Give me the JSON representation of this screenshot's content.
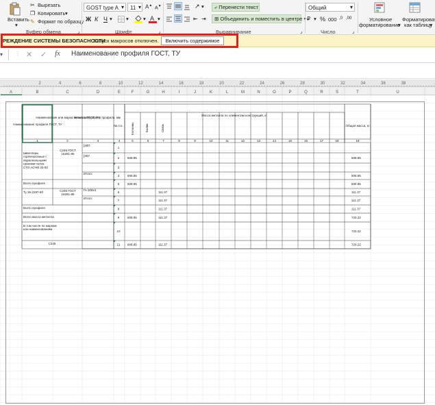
{
  "ribbon": {
    "clipboard": {
      "paste_label": "Вставить",
      "cut_label": "Вырезать",
      "copy_label": "Копировать",
      "format_painter_label": "Формат по образцу",
      "group_label": "Буфер обмена"
    },
    "font": {
      "font_name": "GOST type A",
      "font_size": "11",
      "bold": "Ж",
      "italic": "К",
      "underline": "Ч",
      "group_label": "Шрифт"
    },
    "alignment": {
      "wrap_text_label": "Перенести текст",
      "merge_label": "Объединить и поместить в центре",
      "group_label": "Выравнивание"
    },
    "number": {
      "format": "Общий",
      "percent": "%",
      "thousands": "000",
      "dec_inc": ",0",
      "dec_dec": ",00",
      "group_label": "Число"
    },
    "styles": {
      "conditional_label_1": "Условное",
      "conditional_label_2": "форматирование",
      "table_label_1": "Форматировать",
      "table_label_2": "как таблицу"
    },
    "colors": {
      "accent_green": "#217346",
      "font_red": "#e0201e",
      "fill_yellow": "#ffff00"
    }
  },
  "security_bar": {
    "title": "ПРЕДУПРЕЖДЕНИЕ СИСТЕМЫ БЕЗОПАСНОСТИ",
    "visible_title": "РЕЖДЕНИЕ СИСТЕМЫ БЕЗОПАСНОСТИ",
    "message": "Запуск макросов отключен.",
    "button_label": "Включить содержимое",
    "highlight_color": "#e0201e"
  },
  "formula_bar": {
    "cancel": "✕",
    "confirm": "✓",
    "fx": "fx",
    "content": "Наименование профиля ГОСТ, ТУ"
  },
  "ruler_marks": [
    "2",
    "4",
    "6",
    "8",
    "10",
    "12",
    "14",
    "16",
    "18",
    "20",
    "22",
    "24",
    "26",
    "28",
    "30",
    "32",
    "34",
    "36",
    "38"
  ],
  "columns": [
    "A",
    "B",
    "C",
    "D",
    "E",
    "F",
    "G",
    "H",
    "I",
    "J",
    "K",
    "L",
    "M",
    "N",
    "O",
    "P",
    "Q",
    "R",
    "S",
    "T",
    "U"
  ],
  "table": {
    "headers": {
      "col1": "Наименование профиля ГОСТ, ТУ",
      "col2": "Наименование или марка металла ГОСТ, ТУ",
      "col3": "Номер или размер профиля, мм",
      "col4": "№ п.п.",
      "mass_group": "Масса металла по элементам конструкций, кг",
      "el_kolonny": "Колонны",
      "el_balki": "Балки",
      "el_svyazi": "Связь",
      "total": "Общая масса, кг"
    },
    "index_row": [
      "1",
      "2",
      "3",
      "4",
      "5",
      "6",
      "7",
      "8",
      "9",
      "10",
      "11",
      "12",
      "13",
      "14",
      "15",
      "16",
      "17",
      "18",
      "19"
    ],
    "rows": [
      {
        "name": "Швеллеры горячекатаные с параллельными гранями полок СТО АСЧМ 20-93",
        "steel": "С245 ГОСТ 16281-85",
        "profile": "[30П",
        "nn": "1",
        "kol": "",
        "svyaz": "",
        "total": ""
      },
      {
        "name": "",
        "steel": "",
        "profile": "[30У",
        "nn": "2",
        "kol": "608.85",
        "svyaz": "",
        "total": "608.85"
      },
      {
        "name": "",
        "steel": "",
        "profile": "",
        "nn": "3",
        "kol": "",
        "svyaz": "",
        "total": ""
      },
      {
        "name": "",
        "steel": "",
        "profile": "Итого:",
        "nn": "4",
        "kol": "608.85",
        "svyaz": "",
        "total": "608.85"
      },
      {
        "name": "Всего профиля",
        "steel": "",
        "profile": "",
        "nn": "5",
        "kol": "608.85",
        "svyaz": "",
        "total": "608.85"
      },
      {
        "name": "Ту 36-2287-80",
        "steel": "С245 ГОСТ 16281-85",
        "profile": "Гн.100х4",
        "nn": "6",
        "kol": "",
        "svyaz": "111.37",
        "total": "111.37"
      },
      {
        "name": "",
        "steel": "",
        "profile": "Итого:",
        "nn": "7",
        "kol": "",
        "svyaz": "111.37",
        "total": "111.37"
      },
      {
        "name": "Всего профиля",
        "steel": "",
        "profile": "",
        "nn": "8",
        "kol": "",
        "svyaz": "111.37",
        "total": "111.37"
      },
      {
        "name": "Всего масса металла",
        "steel": "",
        "profile": "",
        "nn": "9",
        "kol": "608.85",
        "svyaz": "111.37",
        "total": "720.22"
      },
      {
        "name": "В том числе по маркам или наименованиям",
        "steel": "",
        "profile": "",
        "nn": "10",
        "kol": "",
        "svyaz": "",
        "total": "720.22"
      },
      {
        "name": "С245",
        "steel": "",
        "profile": "",
        "nn": "11",
        "kol": "608.85",
        "svyaz": "111.37",
        "total": "720.22"
      }
    ]
  }
}
